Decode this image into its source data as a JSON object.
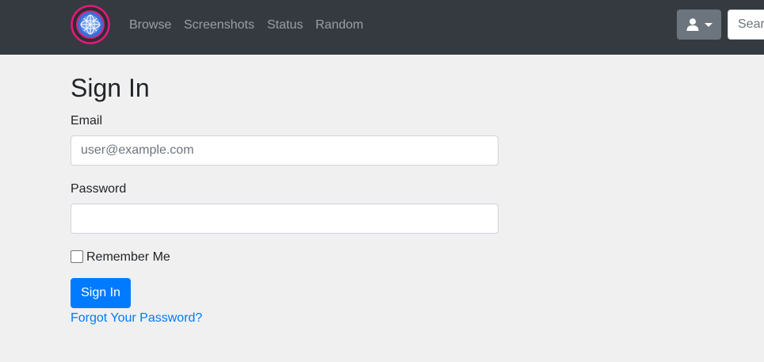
{
  "nav": {
    "links": [
      "Browse",
      "Screenshots",
      "Status",
      "Random"
    ],
    "search_placeholder": "Search"
  },
  "icons": {
    "logo": "globe-logo-icon",
    "user": "user-icon",
    "caret": "caret-down-icon"
  },
  "form": {
    "title": "Sign In",
    "email_label": "Email",
    "email_placeholder": "user@example.com",
    "password_label": "Password",
    "remember_label": "Remember Me",
    "submit_label": "Sign In",
    "forgot_link": "Forgot Your Password?"
  },
  "colors": {
    "navbar_bg": "#343a40",
    "primary": "#007bff",
    "page_bg": "#f0f0f0",
    "user_button_bg": "#6c757d",
    "logo_ring": "#e6197a",
    "logo_globe": "#3a6fd8"
  }
}
